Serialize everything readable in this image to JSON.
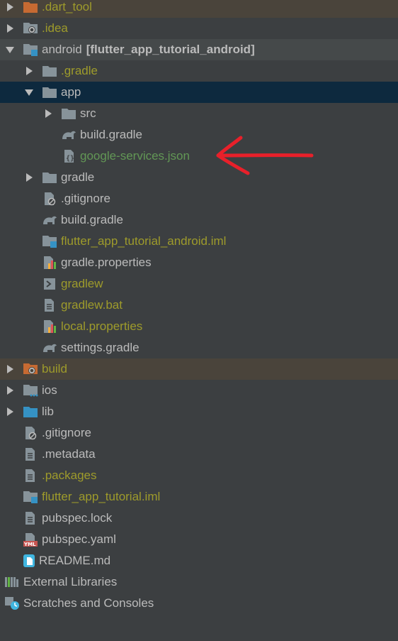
{
  "tree": {
    "items": [
      {
        "label": ".dart_tool",
        "icon": "folder-icon-orange",
        "color": "#9e9b2b"
      },
      {
        "label": ".idea",
        "icon": "idea-folder-icon",
        "color": "#9e9b2b"
      },
      {
        "label": "android",
        "module_label": "[flutter_app_tutorial_android]",
        "icon": "module-folder-icon"
      },
      {
        "label": ".gradle",
        "icon": "folder-icon",
        "color": "#9e9b2b"
      },
      {
        "label": "app",
        "icon": "folder-icon"
      },
      {
        "label": "src",
        "icon": "folder-icon"
      },
      {
        "label": "build.gradle",
        "icon": "gradle-icon"
      },
      {
        "label": "google-services.json",
        "icon": "json-icon",
        "color": "#629755"
      },
      {
        "label": "gradle",
        "icon": "folder-icon"
      },
      {
        "label": ".gitignore",
        "icon": "gitignore-icon"
      },
      {
        "label": "build.gradle",
        "icon": "gradle-icon"
      },
      {
        "label": "flutter_app_tutorial_android.iml",
        "icon": "iml-icon",
        "color": "#9e9b2b"
      },
      {
        "label": "gradle.properties",
        "icon": "properties-icon"
      },
      {
        "label": "gradlew",
        "icon": "terminal-icon",
        "color": "#9e9b2b"
      },
      {
        "label": "gradlew.bat",
        "icon": "text-file-icon",
        "color": "#9e9b2b"
      },
      {
        "label": "local.properties",
        "icon": "properties-icon",
        "color": "#9e9b2b"
      },
      {
        "label": "settings.gradle",
        "icon": "gradle-icon"
      },
      {
        "label": "build",
        "icon": "folder-icon-orange",
        "color": "#9e9b2b"
      },
      {
        "label": "ios",
        "icon": "ios-folder-icon"
      },
      {
        "label": "lib",
        "icon": "lib-folder-icon"
      },
      {
        "label": ".gitignore",
        "icon": "gitignore-icon"
      },
      {
        "label": ".metadata",
        "icon": "text-file-icon"
      },
      {
        "label": ".packages",
        "icon": "text-file-icon",
        "color": "#9e9b2b"
      },
      {
        "label": "flutter_app_tutorial.iml",
        "icon": "iml-icon",
        "color": "#9e9b2b"
      },
      {
        "label": "pubspec.lock",
        "icon": "text-file-icon"
      },
      {
        "label": "pubspec.yaml",
        "icon": "yaml-icon"
      },
      {
        "label": "README.md",
        "icon": "markdown-icon"
      },
      {
        "label": "External Libraries",
        "icon": "libraries-icon"
      },
      {
        "label": "Scratches and Consoles",
        "icon": "scratches-icon"
      }
    ]
  },
  "annotation": {
    "color": "#e8202a",
    "icon": "red-arrow-pointer"
  }
}
